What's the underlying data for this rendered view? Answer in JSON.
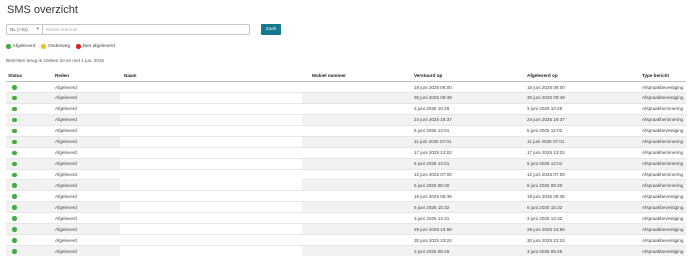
{
  "page_title": "SMS overzicht",
  "search": {
    "country_value": "NL (+31)",
    "phone_placeholder": "Mobiel nummer",
    "button_label": "Zoek"
  },
  "legend": [
    {
      "label": "Afgeleverd",
      "color": "#3fae3f"
    },
    {
      "label": "Onderweg",
      "color": "#f2c21b"
    },
    {
      "label": "Niet afgeleverd",
      "color": "#e02020"
    }
  ],
  "note": "Berichten terug te zoeken tot en met 1 jun. 2025",
  "table": {
    "headers": {
      "status": "Status",
      "reden": "Reden",
      "naam": "Naam",
      "mobiel": "Mobiel nummer",
      "verstuurd": "Verstuurd op",
      "afgeleverd": "Afgeleverd op",
      "type": "Type bericht"
    },
    "rows": [
      {
        "reden": "Afgeleverd",
        "verstuurd": "18 juni 2025 08:00",
        "afgeleverd": "18 juni 2025 08:00",
        "type": "Afspraakbevestiging"
      },
      {
        "reden": "Afgeleverd",
        "verstuurd": "30 juni 2025 09:49",
        "afgeleverd": "30 juni 2025 09:49",
        "type": "Afspraakbevestiging"
      },
      {
        "reden": "Afgeleverd",
        "verstuurd": "3 juni 2025 10:26",
        "afgeleverd": "3 juni 2025 10:26",
        "type": "Afspraakherinnering"
      },
      {
        "reden": "Afgeleverd",
        "verstuurd": "24 juni 2025 18:37",
        "afgeleverd": "24 juni 2025 18:37",
        "type": "Afspraakherinnering"
      },
      {
        "reden": "Afgeleverd",
        "verstuurd": "5 juni 2025 12:01",
        "afgeleverd": "5 juni 2025 12:02",
        "type": "Afspraakbevestiging"
      },
      {
        "reden": "Afgeleverd",
        "verstuurd": "11 juni 2025 07:01",
        "afgeleverd": "11 juni 2025 07:01",
        "type": "Afspraakherinnering"
      },
      {
        "reden": "Afgeleverd",
        "verstuurd": "17 juni 2025 13:02",
        "afgeleverd": "17 juni 2025 13:02",
        "type": "Afspraakherinnering"
      },
      {
        "reden": "Afgeleverd",
        "verstuurd": "6 juni 2025 12:01",
        "afgeleverd": "6 juni 2025 12:01",
        "type": "Afspraakherinnering"
      },
      {
        "reden": "Afgeleverd",
        "verstuurd": "12 juni 2025 07:00",
        "afgeleverd": "12 juni 2025 07:00",
        "type": "Afspraakherinnering"
      },
      {
        "reden": "Afgeleverd",
        "verstuurd": "6 juni 2025 08:30",
        "afgeleverd": "6 juni 2025 08:30",
        "type": "Afspraakherinnering"
      },
      {
        "reden": "Afgeleverd",
        "verstuurd": "18 juni 2025 09:36",
        "afgeleverd": "18 juni 2025 09:36",
        "type": "Afspraakbevestiging"
      },
      {
        "reden": "Afgeleverd",
        "verstuurd": "6 juni 2025 15:32",
        "afgeleverd": "6 juni 2025 15:32",
        "type": "Afspraakbevestiging"
      },
      {
        "reden": "Afgeleverd",
        "verstuurd": "3 juni 2025 14:31",
        "afgeleverd": "3 juni 2025 14:32",
        "type": "Afspraakbevestiging"
      },
      {
        "reden": "Afgeleverd",
        "verstuurd": "29 juni 2025 16:56",
        "afgeleverd": "29 juni 2025 16:56",
        "type": "Afspraakbevestiging"
      },
      {
        "reden": "Afgeleverd",
        "verstuurd": "30 juni 2025 23:24",
        "afgeleverd": "30 juni 2025 23:24",
        "type": "Afspraakbevestiging"
      },
      {
        "reden": "Afgeleverd",
        "verstuurd": "3 juni 2025 06:49",
        "afgeleverd": "3 juni 2025 06:49",
        "type": "Afspraakbevestiging"
      }
    ]
  }
}
